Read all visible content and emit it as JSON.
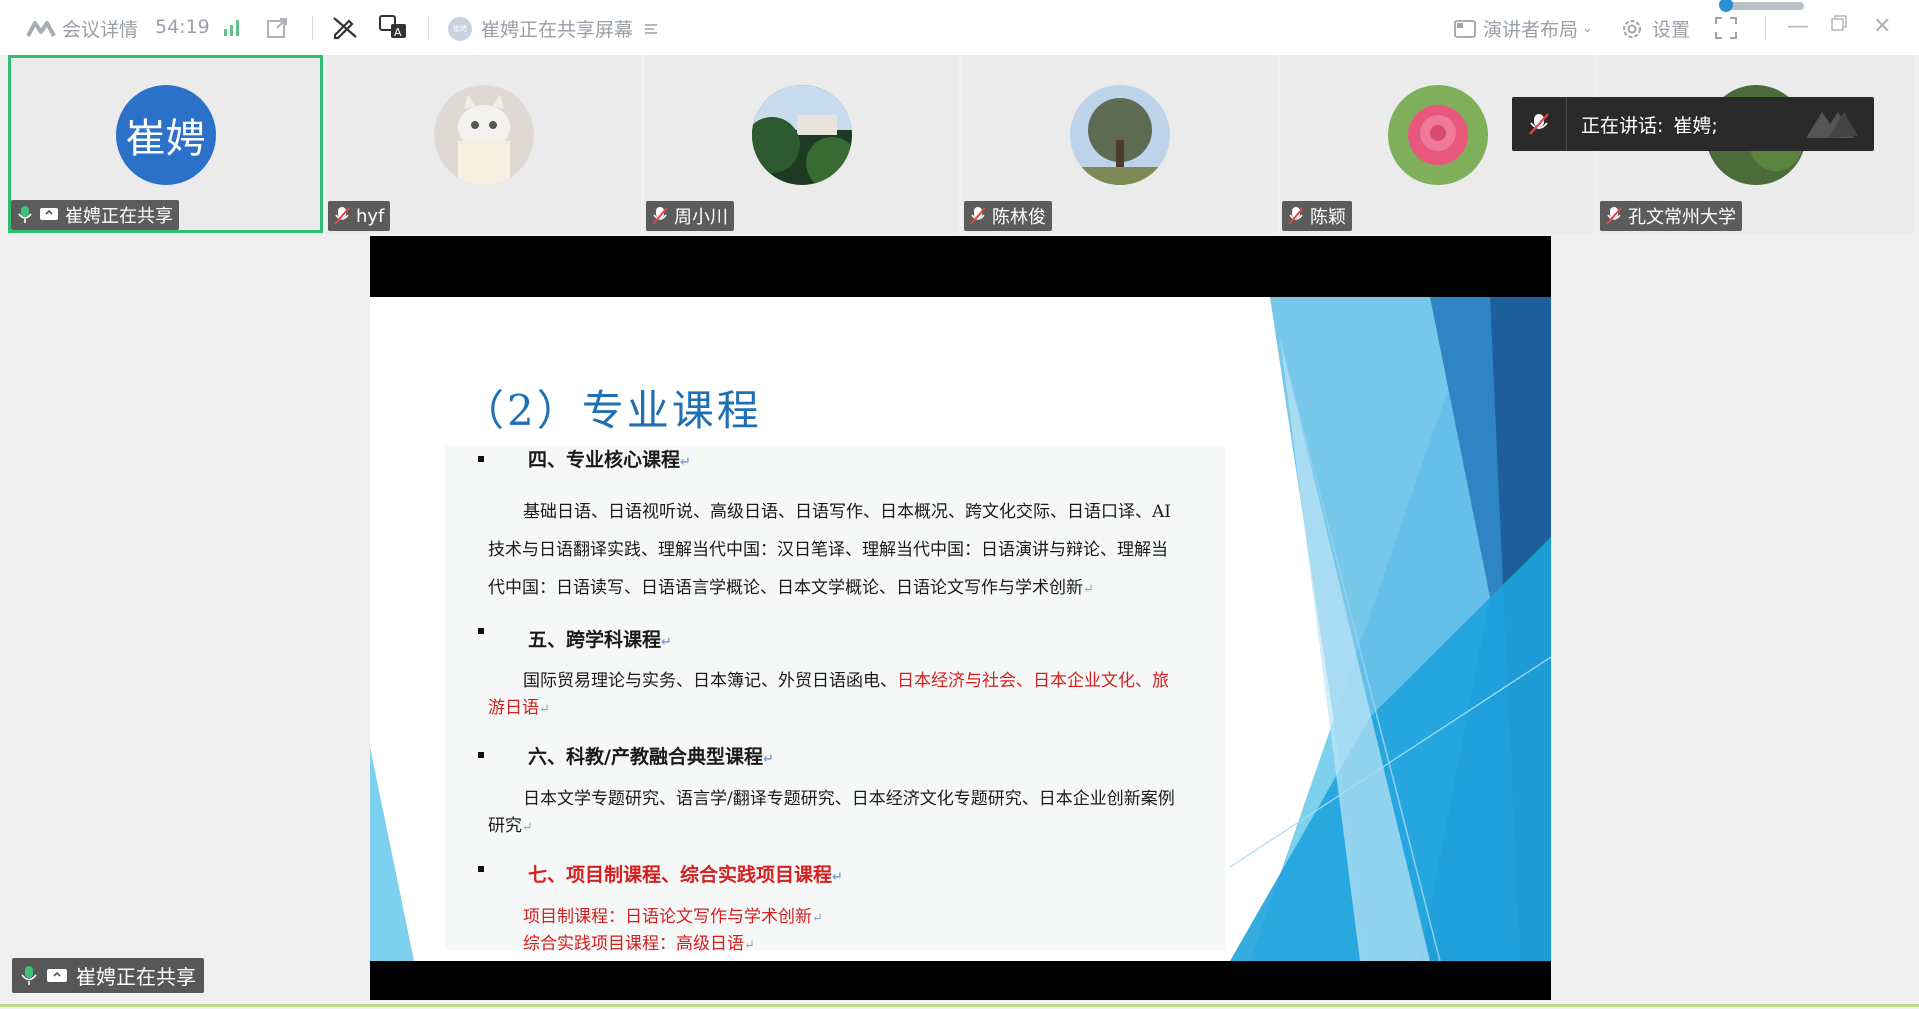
{
  "topbar": {
    "meeting_details": "会议详情",
    "timer": "54:19",
    "sharing_status": "崔娉正在共享屏幕",
    "sharer_avatar_text": "崔娉",
    "layout_label": "演讲者布局",
    "settings_label": "设置"
  },
  "participants": [
    {
      "name": "崔娉正在共享",
      "avatar_text": "崔娉",
      "active": true
    },
    {
      "name": "hyf"
    },
    {
      "name": "周小川"
    },
    {
      "name": "陈林俊"
    },
    {
      "name": "陈颖"
    },
    {
      "name": "孔文常州大学"
    }
  ],
  "speaking": {
    "label": "正在讲话:",
    "name": "崔娉;"
  },
  "slide": {
    "title": "（2）专业课程",
    "sections": [
      {
        "heading": "四、专业核心课程",
        "lines": [
          "基础日语、日语视听说、高级日语、日语写作、日本概况、跨文化交际、日语口译、AI",
          "技术与日语翻译实践、理解当代中国：汉日笔译、理解当代中国：日语演讲与辩论、理解当",
          "代中国：日语读写、日语语言学概论、日本文学概论、日语论文写作与学术创新"
        ]
      },
      {
        "heading": "五、跨学科课程",
        "line1_black": "国际贸易理论与实务、日本簿记、外贸日语函电、",
        "line1_red": "日本经济与社会、日本企业文化、旅",
        "line2_red": "游日语"
      },
      {
        "heading": "六、科教/产教融合典型课程",
        "lines": [
          "日本文学专题研究、语言学/翻译专题研究、日本经济文化专题研究、日本企业创新案例",
          "研究"
        ]
      },
      {
        "heading": "七、项目制课程、综合实践项目课程",
        "lines": [
          "项目制课程：日语论文写作与学术创新",
          "综合实践项目课程：高级日语"
        ]
      }
    ]
  },
  "bottom_share_label": "崔娉正在共享",
  "colors": {
    "accent_green": "#2fbf71",
    "title_blue": "#1f6fb5",
    "red_text": "#d42020",
    "avatar_blue": "#2b71c9"
  }
}
